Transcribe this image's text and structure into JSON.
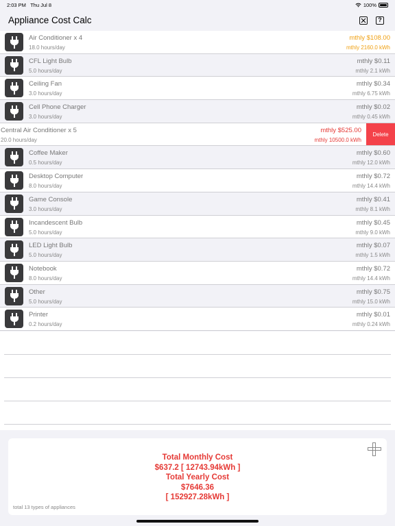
{
  "status_bar": {
    "time": "2:03 PM",
    "date": "Thu Jul 8",
    "battery": "100%"
  },
  "nav": {
    "title": "Appliance Cost Calc",
    "close_icon": "x-square-icon",
    "help_label": "?"
  },
  "appliances": [
    {
      "name": "Air Conditioner x 4",
      "hours": "18.0 hours/day",
      "cost": "mthly $108.00",
      "kwh": "mthly 2160.0 kWh"
    },
    {
      "name": "CFL Light Bulb",
      "hours": "5.0 hours/day",
      "cost": "mthly $0.11",
      "kwh": "mthly 2.1 kWh"
    },
    {
      "name": "Ceiling Fan",
      "hours": "3.0 hours/day",
      "cost": "mthly $0.34",
      "kwh": "mthly 6.75 kWh"
    },
    {
      "name": "Cell Phone Charger",
      "hours": "3.0 hours/day",
      "cost": "mthly $0.02",
      "kwh": "mthly 0.45 kWh"
    },
    {
      "name": "Central Air Conditioner x 5",
      "hours": "20.0 hours/day",
      "cost": "mthly $525.00",
      "kwh": "mthly 10500.0 kWh"
    },
    {
      "name": "Coffee Maker",
      "hours": "0.5 hours/day",
      "cost": "mthly $0.60",
      "kwh": "mthly 12.0 kWh"
    },
    {
      "name": "Desktop Computer",
      "hours": "8.0 hours/day",
      "cost": "mthly $0.72",
      "kwh": "mthly 14.4 kWh"
    },
    {
      "name": "Game Console",
      "hours": "3.0 hours/day",
      "cost": "mthly $0.41",
      "kwh": "mthly 8.1 kWh"
    },
    {
      "name": "Incandescent Bulb",
      "hours": "5.0 hours/day",
      "cost": "mthly $0.45",
      "kwh": "mthly 9.0 kWh"
    },
    {
      "name": "LED Light Bulb",
      "hours": "5.0 hours/day",
      "cost": "mthly $0.07",
      "kwh": "mthly 1.5 kWh"
    },
    {
      "name": "Notebook",
      "hours": "8.0 hours/day",
      "cost": "mthly $0.72",
      "kwh": "mthly 14.4 kWh"
    },
    {
      "name": "Other",
      "hours": "5.0 hours/day",
      "cost": "mthly $0.75",
      "kwh": "mthly 15.0 kWh"
    },
    {
      "name": "Printer",
      "hours": "0.2 hours/day",
      "cost": "mthly $0.01",
      "kwh": "mthly 0.24 kWh"
    }
  ],
  "delete_label": "Delete",
  "totals": {
    "monthly_label": "Total Monthly Cost",
    "monthly_value": "$637.2 [ 12743.94kWh ]",
    "yearly_label": "Total Yearly Cost",
    "yearly_cost": "$7646.36",
    "yearly_kwh": "[ 152927.28kWh ]",
    "footer": "total 13 types of appliances"
  },
  "colors": {
    "highlight": "#f0a012",
    "alert": "#e53935",
    "delete": "#f4424a",
    "icon_bg": "#3a3a3c"
  },
  "icons": {
    "appliance": "plug-icon",
    "add": "plus-icon",
    "wifi": "wifi-icon",
    "battery": "battery-icon"
  }
}
